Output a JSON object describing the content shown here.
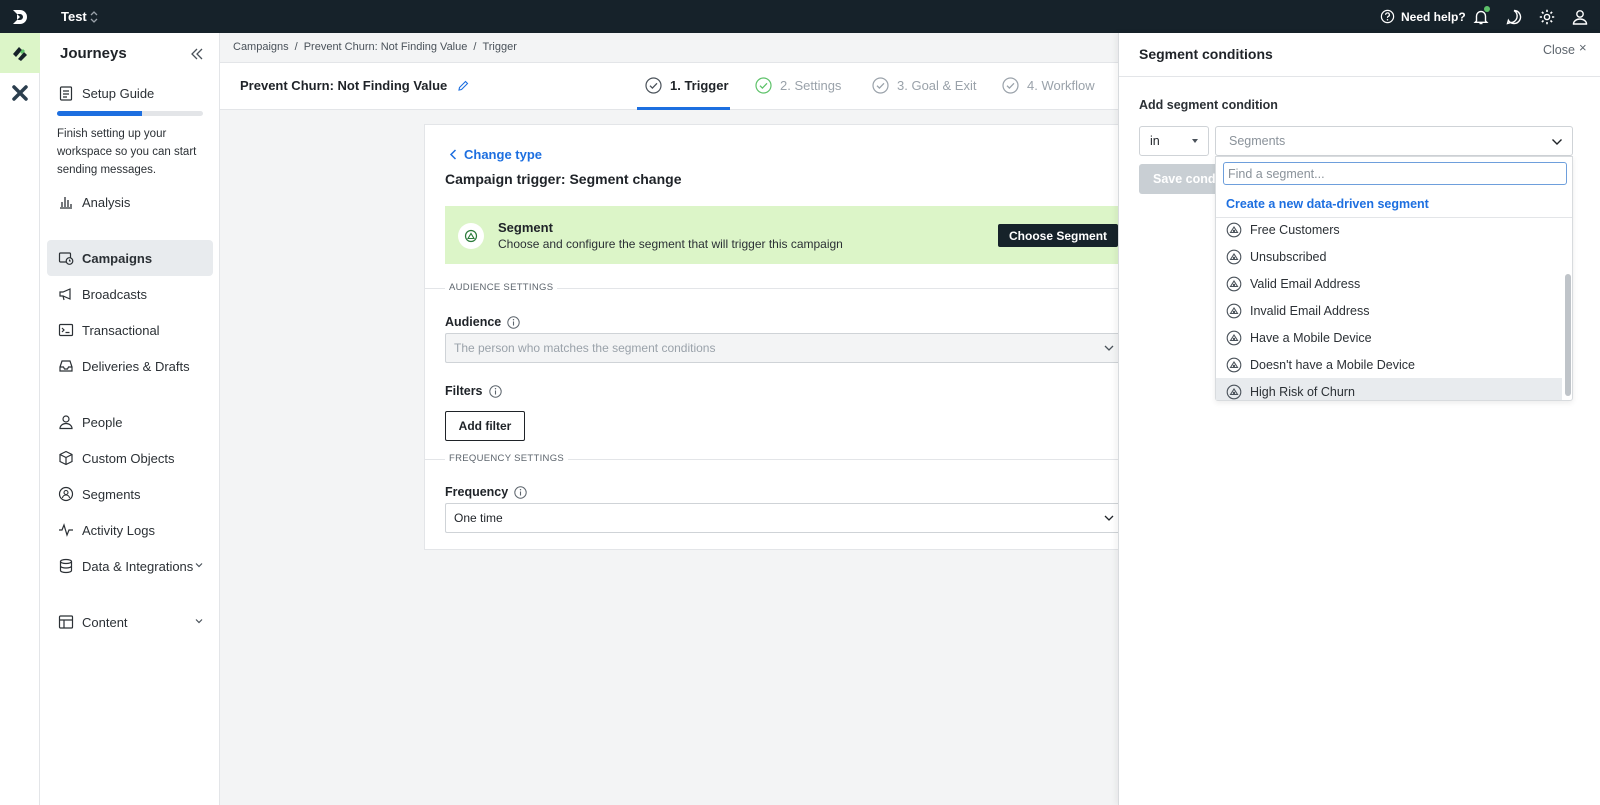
{
  "topbar": {
    "workspace": "Test",
    "help_label": "Need help?"
  },
  "sidebar": {
    "title": "Journeys",
    "setup": {
      "label": "Setup Guide",
      "progress_percent": 58,
      "description": "Finish setting up your workspace so you can start sending messages."
    },
    "items": [
      {
        "label": "Analysis"
      },
      {
        "label": "Campaigns"
      },
      {
        "label": "Broadcasts"
      },
      {
        "label": "Transactional"
      },
      {
        "label": "Deliveries & Drafts"
      },
      {
        "label": "People"
      },
      {
        "label": "Custom Objects"
      },
      {
        "label": "Segments"
      },
      {
        "label": "Activity Logs"
      },
      {
        "label": "Data & Integrations"
      },
      {
        "label": "Content"
      }
    ]
  },
  "breadcrumb": {
    "items": [
      "Campaigns",
      "Prevent Churn: Not Finding Value",
      "Trigger"
    ],
    "sep": "/"
  },
  "header": {
    "campaign_name": "Prevent Churn: Not Finding Value",
    "steps": [
      {
        "label": "1. Trigger"
      },
      {
        "label": "2. Settings"
      },
      {
        "label": "3. Goal & Exit"
      },
      {
        "label": "4. Workflow"
      }
    ]
  },
  "trigger": {
    "change_type": "Change type",
    "title": "Campaign trigger: Segment change",
    "banner": {
      "title": "Segment",
      "desc": "Choose and configure the segment that will trigger this campaign",
      "button": "Choose Segment"
    },
    "audience_settings": "AUDIENCE SETTINGS",
    "audience_label": "Audience",
    "audience_value": "The person who matches the segment conditions",
    "filters_label": "Filters",
    "add_filter": "Add filter",
    "frequency_settings": "FREQUENCY SETTINGS",
    "frequency_label": "Frequency",
    "frequency_value": "One time"
  },
  "panel": {
    "title": "Segment conditions",
    "close": "Close",
    "close_x": "×",
    "add_condition": "Add segment condition",
    "in_value": "in",
    "segment_placeholder": "Segments",
    "save_button": "Save condition",
    "search_placeholder": "Find a segment...",
    "create_link": "Create a new data-driven segment",
    "options": [
      "Free Customers",
      "Unsubscribed",
      "Valid Email Address",
      "Invalid Email Address",
      "Have a Mobile Device",
      "Doesn't have a Mobile Device",
      "High Risk of Churn"
    ],
    "highlighted": "High Risk of Churn"
  },
  "colors": {
    "accent": "#1d6fe0",
    "topbar": "#16222a",
    "banner": "#dcf5c8",
    "success": "#5ec26a"
  }
}
